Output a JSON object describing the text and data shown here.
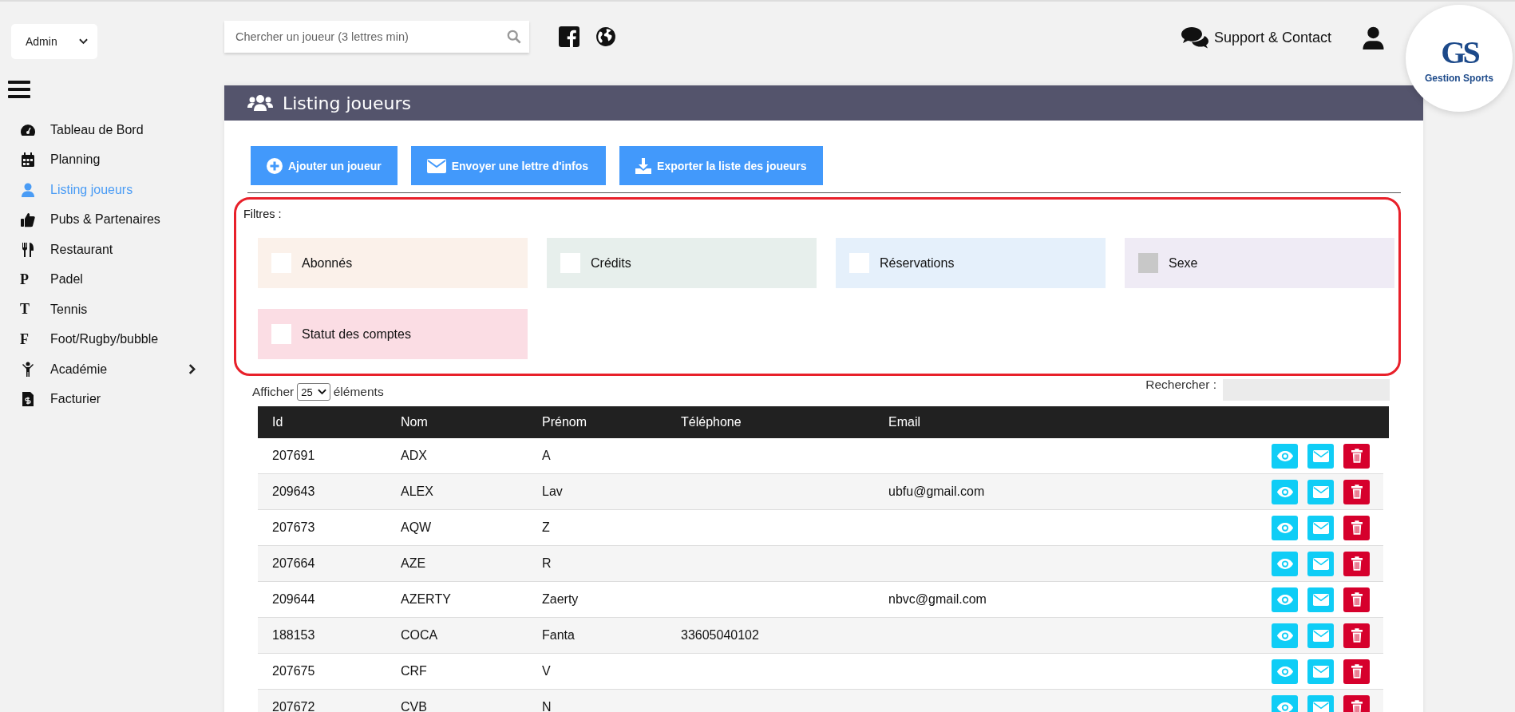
{
  "role_select": {
    "value": "Admin"
  },
  "sidebar": {
    "items": [
      {
        "label": "Tableau de Bord",
        "selected": false,
        "has_submenu": false
      },
      {
        "label": "Planning",
        "selected": false,
        "has_submenu": false
      },
      {
        "label": "Listing joueurs",
        "selected": true,
        "has_submenu": false
      },
      {
        "label": "Pubs & Partenaires",
        "selected": false,
        "has_submenu": false
      },
      {
        "label": "Restaurant",
        "selected": false,
        "has_submenu": false
      },
      {
        "label": "Padel",
        "letter": "P",
        "selected": false,
        "has_submenu": false
      },
      {
        "label": "Tennis",
        "letter": "T",
        "selected": false,
        "has_submenu": false
      },
      {
        "label": "Foot/Rugby/bubble",
        "letter": "F",
        "selected": false,
        "has_submenu": false
      },
      {
        "label": "Académie",
        "selected": false,
        "has_submenu": true
      },
      {
        "label": "Facturier",
        "selected": false,
        "has_submenu": false
      }
    ]
  },
  "header": {
    "search": {
      "placeholder": "Chercher un joueur (3 lettres min)"
    },
    "support": "Support & Contact",
    "logo": {
      "mark": "GS",
      "name": "Gestion Sports"
    }
  },
  "panel": {
    "title": "Listing joueurs",
    "buttons": [
      "Ajouter un joueur",
      "Envoyer une lettre d'infos",
      "Exporter la liste des joueurs"
    ],
    "filters": {
      "label": "Filtres :",
      "items": [
        {
          "label": "Abonnés",
          "checked": false,
          "disabled": false,
          "color": "#fbf1ea"
        },
        {
          "label": "Crédits",
          "checked": false,
          "disabled": false,
          "color": "#e7efec"
        },
        {
          "label": "Réservations",
          "checked": false,
          "disabled": false,
          "color": "#e5f0fb"
        },
        {
          "label": "Sexe",
          "checked": false,
          "disabled": true,
          "color": "#efebf5"
        },
        {
          "label": "Statut des comptes",
          "checked": false,
          "disabled": false,
          "color": "#fbdde4"
        }
      ]
    },
    "table": {
      "show_label": "Afficher",
      "page_size": "25",
      "show_suffix": "éléments",
      "search_label": "Rechercher :",
      "columns": [
        "Id",
        "Nom",
        "Prénom",
        "Téléphone",
        "Email"
      ],
      "rows": [
        [
          "207691",
          "ADX",
          "A",
          "",
          ""
        ],
        [
          "209643",
          "ALEX",
          "Lav",
          "",
          "ubfu@gmail.com"
        ],
        [
          "207673",
          "AQW",
          "Z",
          "",
          ""
        ],
        [
          "207664",
          "AZE",
          "R",
          "",
          ""
        ],
        [
          "209644",
          "AZERTY",
          "Zaerty",
          "",
          "nbvc@gmail.com"
        ],
        [
          "188153",
          "COCA",
          "Fanta",
          "33605040102",
          ""
        ],
        [
          "207675",
          "CRF",
          "V",
          "",
          ""
        ],
        [
          "207672",
          "CVB",
          "N",
          "",
          ""
        ]
      ]
    }
  }
}
